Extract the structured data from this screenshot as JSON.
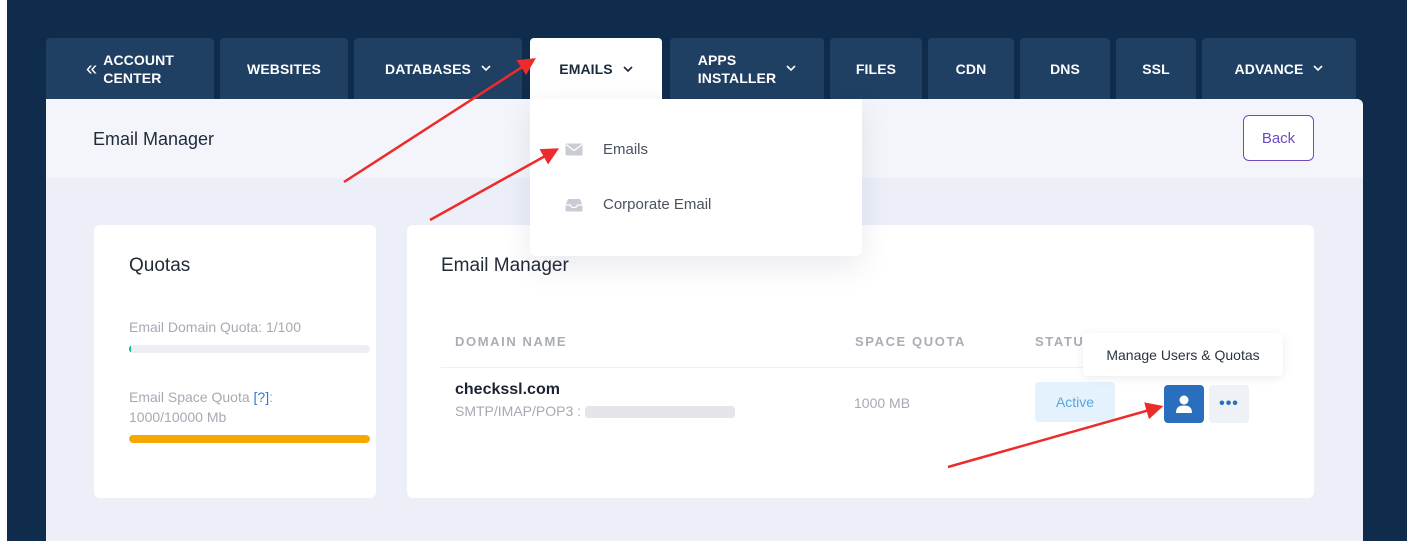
{
  "tabs": [
    {
      "label": "ACCOUNT CENTER",
      "line1": "ACCOUNT",
      "line2": "CENTER",
      "icon": "chevrons-left-icon"
    },
    {
      "label": "WEBSITES"
    },
    {
      "label": "DATABASES",
      "dropdown": true
    },
    {
      "label": "EMAILS",
      "dropdown": true,
      "active": true
    },
    {
      "label": "APPS INSTALLER",
      "line1": "APPS",
      "line2": "INSTALLER",
      "dropdown": true
    },
    {
      "label": "FILES"
    },
    {
      "label": "CDN"
    },
    {
      "label": "DNS"
    },
    {
      "label": "SSL"
    },
    {
      "label": "ADVANCE",
      "dropdown": true
    }
  ],
  "header": {
    "title": "Email Manager",
    "back_label": "Back"
  },
  "dropdown": {
    "items": [
      {
        "label": "Emails",
        "icon": "envelope-icon"
      },
      {
        "label": "Corporate Email",
        "icon": "inbox-tray-icon"
      }
    ]
  },
  "quotas": {
    "title": "Quotas",
    "domain_quota_label": "Email Domain Quota: 1/100",
    "domain_quota_fraction": 0.01,
    "space_quota_label_prefix": "Email Space Quota ",
    "space_quota_help": "[?]",
    "space_quota_label_suffix": ":",
    "space_quota_value": "1000/10000 Mb",
    "space_quota_fraction": 1.0
  },
  "email_manager": {
    "title": "Email Manager",
    "columns": {
      "domain": "DOMAIN NAME",
      "space": "SPACE QUOTA",
      "status": "STATUS"
    },
    "rows": [
      {
        "domain": "checkssl.com",
        "smtp_label": "SMTP/IMAP/POP3 :",
        "space_quota": "1000 MB",
        "status": "Active"
      }
    ],
    "tooltip": "Manage Users & Quotas"
  },
  "colors": {
    "background": "#0f2c4c",
    "tab": "#1f3f63",
    "primary_button": "#2a6fbd",
    "back_button": "#6c4bc2",
    "space_quota_bar": "#f6a800",
    "domain_quota_bar": "#13b6a0",
    "annotation_arrow": "#ee2b2b"
  }
}
